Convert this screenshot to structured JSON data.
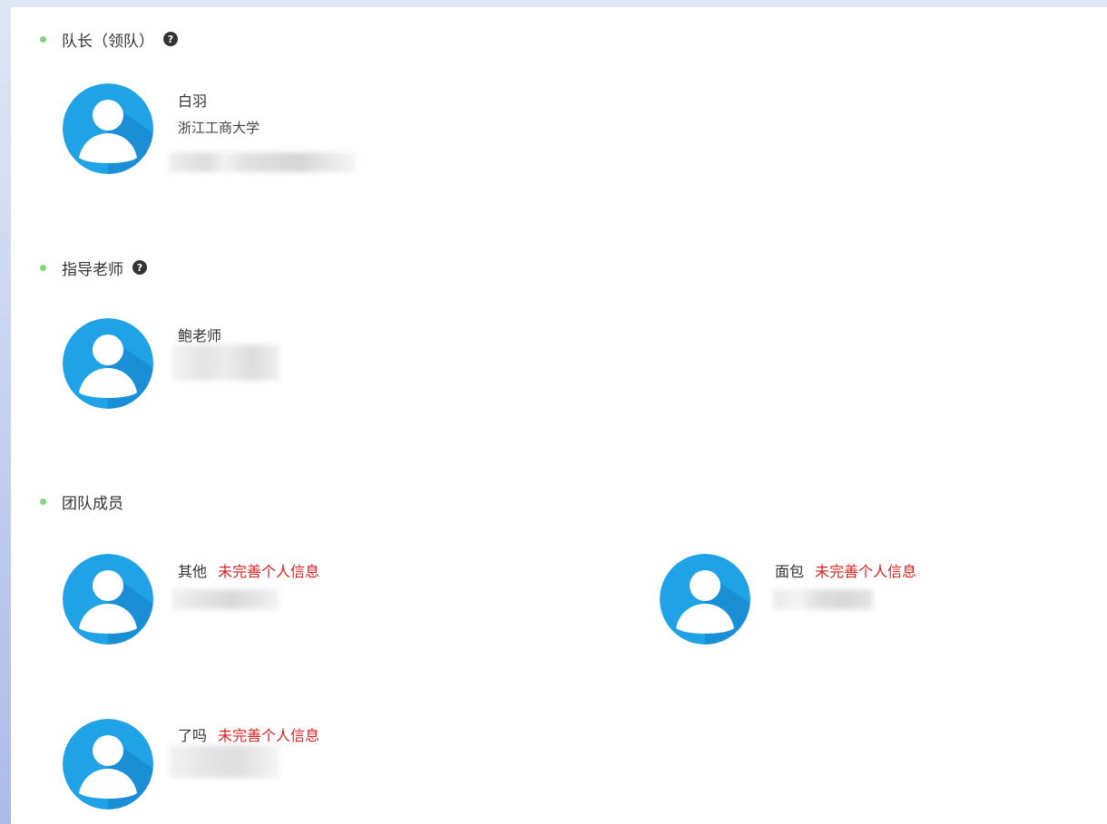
{
  "leader": {
    "heading": "队长（领队）",
    "help_glyph": "?",
    "name": "白羽",
    "school": "浙江工商大学"
  },
  "advisor": {
    "heading": "指导老师",
    "help_glyph": "?",
    "name": "鲍老师"
  },
  "members": {
    "heading": "团队成员",
    "items": [
      {
        "name": "其他",
        "status": "未完善个人信息"
      },
      {
        "name": "面包",
        "status": "未完善个人信息"
      },
      {
        "name": "了吗",
        "status": "未完善个人信息"
      }
    ]
  },
  "colors": {
    "bullet": "#7ed67e",
    "avatar_bg": "#1fa3e6",
    "avatar_shadow": "#1478c4",
    "warning_text": "#e02020"
  }
}
